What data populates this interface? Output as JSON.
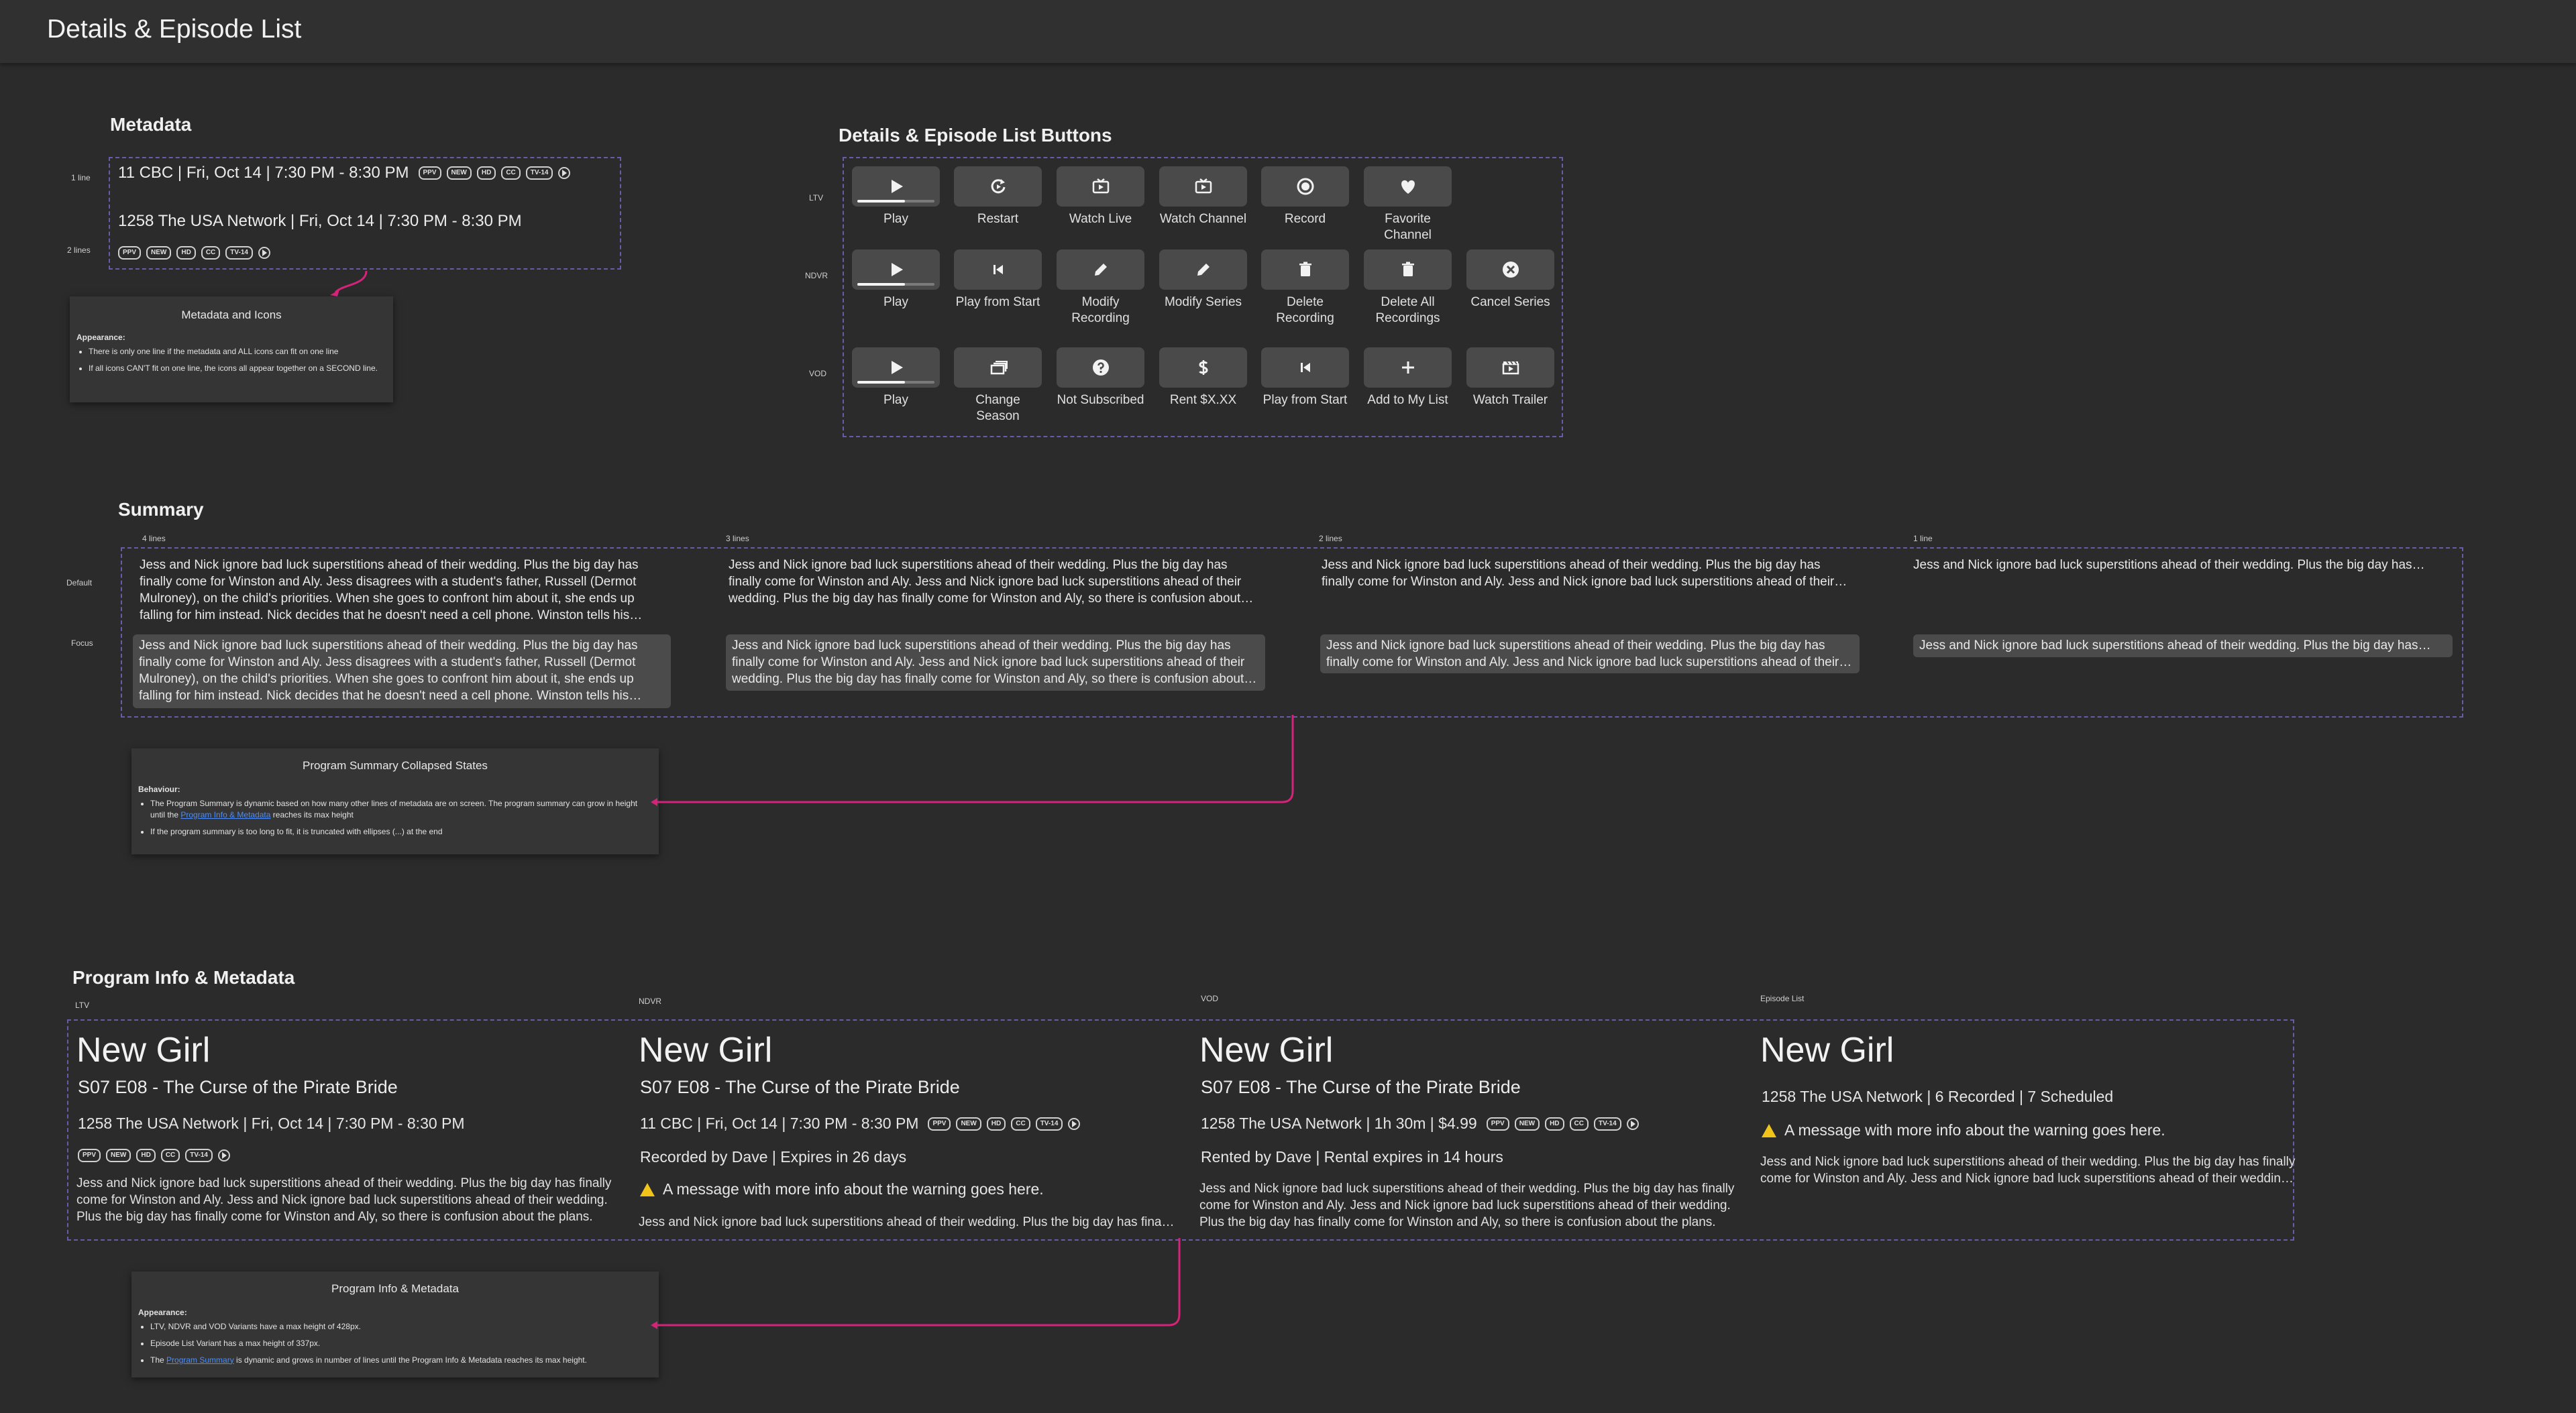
{
  "page": {
    "title": "Details & Episode List"
  },
  "metadata": {
    "heading": "Metadata",
    "label_1line": "1 line",
    "label_2lines": "2 lines",
    "line1_text": "11 CBC |  Fri, Oct 14  |  7:30 PM - 8:30 PM",
    "line2_text": "1258 The USA Network |  Fri, Oct 14  |  7:30 PM - 8:30 PM",
    "badges": [
      "PPV",
      "NEW",
      "HD",
      "CC",
      "TV-14"
    ],
    "note": {
      "title": "Metadata and Icons",
      "heading": "Appearance:",
      "items": [
        "There is only one line if the metadata and ALL icons can fit on one line",
        "If all icons CAN'T fit on one line, the icons all appear together on a SECOND line."
      ]
    }
  },
  "buttons": {
    "heading": "Details & Episode List Buttons",
    "rows": [
      {
        "label": "LTV",
        "items": [
          {
            "icon": "play-icon",
            "label": "Play",
            "progress": 0.62
          },
          {
            "icon": "restart-icon",
            "label": "Restart"
          },
          {
            "icon": "tv-play-icon",
            "label": "Watch Live"
          },
          {
            "icon": "tv-play-icon",
            "label": "Watch Channel"
          },
          {
            "icon": "record-icon",
            "label": "Record"
          },
          {
            "icon": "heart-icon",
            "label": "Favorite Channel"
          }
        ]
      },
      {
        "label": "NDVR",
        "items": [
          {
            "icon": "play-icon",
            "label": "Play",
            "progress": 0.62
          },
          {
            "icon": "skip-back-icon",
            "label": "Play from Start"
          },
          {
            "icon": "pencil-icon",
            "label": "Modify Recording"
          },
          {
            "icon": "pencil-icon",
            "label": "Modify Series"
          },
          {
            "icon": "trash-icon",
            "label": "Delete Recording"
          },
          {
            "icon": "trash-icon",
            "label": "Delete All Recordings"
          },
          {
            "icon": "cancel-icon",
            "label": "Cancel Series"
          }
        ]
      },
      {
        "label": "VOD",
        "items": [
          {
            "icon": "play-icon",
            "label": "Play",
            "progress": 0.62
          },
          {
            "icon": "season-icon",
            "label": "Change Season"
          },
          {
            "icon": "question-icon",
            "label": "Not Subscribed"
          },
          {
            "icon": "dollar-icon",
            "label": "Rent $X.XX"
          },
          {
            "icon": "skip-back-icon",
            "label": "Play from Start"
          },
          {
            "icon": "plus-icon",
            "label": "Add to My List"
          },
          {
            "icon": "trailer-icon",
            "label": "Watch Trailer"
          }
        ]
      }
    ]
  },
  "summary": {
    "heading": "Summary",
    "row_default": "Default",
    "row_focus": "Focus",
    "columns": [
      {
        "label": "4 lines",
        "lines": 4
      },
      {
        "label": "3 lines",
        "lines": 3
      },
      {
        "label": "2 lines",
        "lines": 2
      },
      {
        "label": "1 line",
        "lines": 1
      }
    ],
    "text": "Jess and Nick ignore bad luck superstitions ahead of their wedding. Plus the big day has finally come for Winston and Aly. Jess disagrees with a student's father, Russell (Dermot Mulroney), on the child's priorities. When she goes to confront him about it, she ends up falling for him instead. Nick decides that he doesn't need a cell phone. Winston tells his friends about his plans.",
    "text_short": "Jess and Nick ignore bad luck superstitions ahead of their wedding. Plus the big day has finally come for Winston and Aly. Jess and Nick ignore bad luck superstitions ahead of their wedding. Plus the big day has finally come for Winston and Aly, so there is confusion about the plans.",
    "note": {
      "title": "Program Summary Collapsed States",
      "heading": "Behaviour:",
      "item1_pre": "The Program Summary is dynamic based on how many other lines of metadata are on screen. The program summary can grow in height until the ",
      "item1_link": "Program Info & Metadata",
      "item1_post": " reaches its max height",
      "item2": "If the program summary is too long to fit, it is truncated with ellipses (...) at the end"
    }
  },
  "program_info": {
    "heading": "Program Info & Metadata",
    "variants": [
      {
        "label": "LTV",
        "title": "New Girl",
        "episode": "S07 E08 - The Curse of the Pirate Bride",
        "meta": "1258 The USA Network |  Fri, Oct 14  |  7:30 PM - 8:30 PM"
      },
      {
        "label": "NDVR",
        "title": "New Girl",
        "episode": "S07 E08 - The Curse of the Pirate Bride",
        "meta": "11 CBC |  Fri, Oct 14  |  7:30 PM - 8:30 PM",
        "extra": "Recorded by Dave  |  Expires in 26 days",
        "warning": "A message with more info about the warning goes here."
      },
      {
        "label": "VOD",
        "title": "New Girl",
        "episode": "S07 E08 - The Curse of the Pirate Bride",
        "meta": "1258 The USA Network |  1h 30m  |  $4.99",
        "extra": "Rented by Dave  |  Rental expires in 14 hours"
      },
      {
        "label": "Episode List",
        "title": "New Girl",
        "meta": "1258 The USA Network |  6 Recorded  |  7 Scheduled",
        "warning": "A message with more info about the warning goes here."
      }
    ],
    "note": {
      "title": "Program Info & Metadata",
      "heading": "Appearance:",
      "item1": "LTV, NDVR and VOD Variants have a max height of 428px.",
      "item2": "Episode List Variant has a max height of 337px.",
      "item3_pre": "The ",
      "item3_link": "Program Summary",
      "item3_post": " is dynamic and grows  in number of lines until the Program Info & Metadata reaches its max height."
    }
  },
  "colors": {
    "background": "#2b2b2b",
    "accent_line": "#d4247a",
    "dashed_border": "#6b5aa8",
    "link": "#4d8df5",
    "warning": "#f0c419"
  }
}
